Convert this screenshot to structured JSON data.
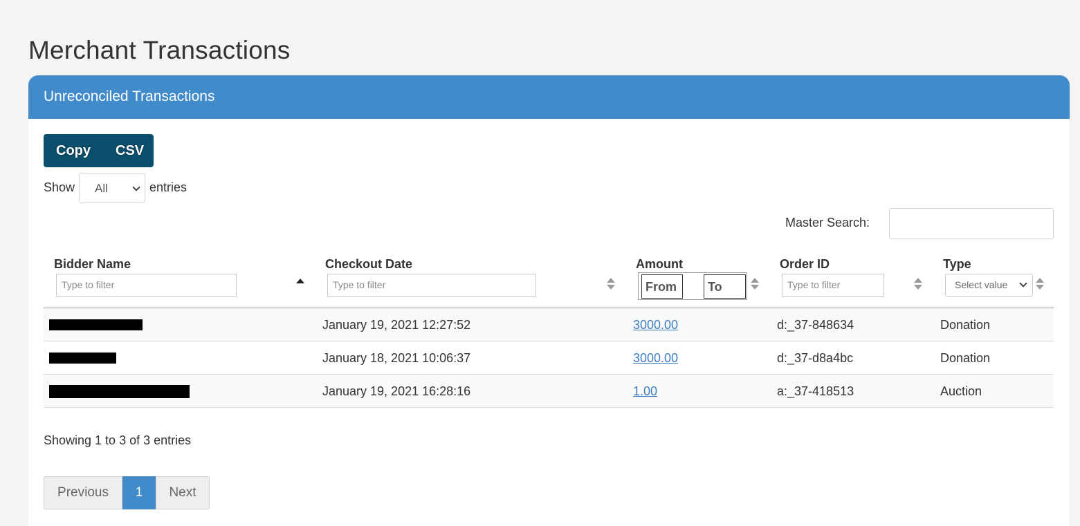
{
  "page": {
    "title": "Merchant Transactions"
  },
  "card": {
    "title": "Unreconciled Transactions"
  },
  "toolbar": {
    "copy_label": "Copy",
    "csv_label": "CSV"
  },
  "length": {
    "show_label": "Show",
    "selected": "All",
    "entries_label": "entries"
  },
  "search": {
    "label": "Master Search:",
    "value": ""
  },
  "columns": [
    {
      "label": "Bidder Name",
      "filter_placeholder": "Type to filter",
      "sort": "ascending"
    },
    {
      "label": "Checkout Date",
      "filter_placeholder": "Type to filter",
      "sort": "none"
    },
    {
      "label": "Amount",
      "range_from": "From",
      "range_to": "To",
      "sort": "none"
    },
    {
      "label": "Order ID",
      "filter_placeholder": "Type to filter",
      "sort": "none"
    },
    {
      "label": "Type",
      "select_placeholder": "Select value",
      "sort": "none"
    }
  ],
  "rows": [
    {
      "bidder": "[redacted]",
      "date": "January 19, 2021 12:27:52",
      "amount": "3000.00",
      "order_id": "d:_37-848634",
      "type": "Donation"
    },
    {
      "bidder": "[redacted]",
      "date": "January 18, 2021 10:06:37",
      "amount": "3000.00",
      "order_id": "d:_37-d8a4bc",
      "type": "Donation"
    },
    {
      "bidder": "[redacted]",
      "date": "January 19, 2021 16:28:16",
      "amount": "1.00",
      "order_id": "a:_37-418513",
      "type": "Auction"
    }
  ],
  "info": "Showing 1 to 3 of 3 entries",
  "pagination": {
    "previous": "Previous",
    "current": "1",
    "next": "Next"
  },
  "colors": {
    "header_blue": "#418bca",
    "button_dark": "#0b4f6c",
    "link": "#3e7fc2"
  }
}
